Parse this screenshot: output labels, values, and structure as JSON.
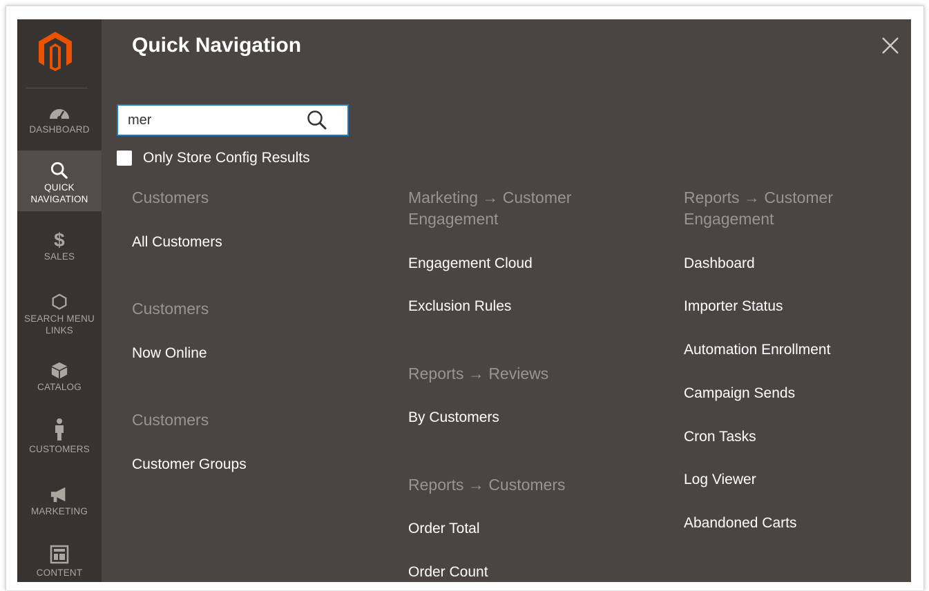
{
  "sidebar": {
    "items": [
      {
        "label": "Dashboard",
        "icon": "dashboard-icon"
      },
      {
        "label": "Quick Navigation",
        "icon": "search-icon"
      },
      {
        "label": "Sales",
        "icon": "dollar-icon"
      },
      {
        "label": "Search Menu Links",
        "icon": "hexagon-icon"
      },
      {
        "label": "Catalog",
        "icon": "cube-icon"
      },
      {
        "label": "Customers",
        "icon": "person-icon"
      },
      {
        "label": "Marketing",
        "icon": "megaphone-icon"
      },
      {
        "label": "Content",
        "icon": "layout-icon"
      }
    ],
    "colors": {
      "background": "#373330",
      "active": "#524d49",
      "text": "#aaa6a0",
      "logo": "#eb5202"
    }
  },
  "panel": {
    "title": "Quick Navigation",
    "search": {
      "value": "mer"
    },
    "config_filter": {
      "label": "Only Store Config Results",
      "checked": false
    },
    "columns": [
      {
        "groups": [
          {
            "title": "Customers",
            "links": [
              "All Customers"
            ]
          },
          {
            "title": "Customers",
            "links": [
              "Now Online"
            ]
          },
          {
            "title": "Customers",
            "links": [
              "Customer Groups"
            ]
          }
        ]
      },
      {
        "groups": [
          {
            "title": "Marketing → Customer Engagement",
            "links": [
              "Engagement Cloud",
              "Exclusion Rules"
            ]
          },
          {
            "title": "Reports → Reviews",
            "links": [
              "By Customers"
            ]
          },
          {
            "title": "Reports → Customers",
            "links": [
              "Order Total",
              "Order Count"
            ]
          }
        ]
      },
      {
        "groups": [
          {
            "title": "Reports → Customer Engagement",
            "links": [
              "Dashboard",
              "Importer Status",
              "Automation Enrollment",
              "Campaign Sends",
              "Cron Tasks",
              "Log Viewer",
              "Abandoned Carts"
            ]
          }
        ]
      }
    ],
    "colors": {
      "background": "#4a4542",
      "group_title": "#9a948f",
      "link": "#ffffff",
      "search_border": "#1e7cc0"
    }
  }
}
